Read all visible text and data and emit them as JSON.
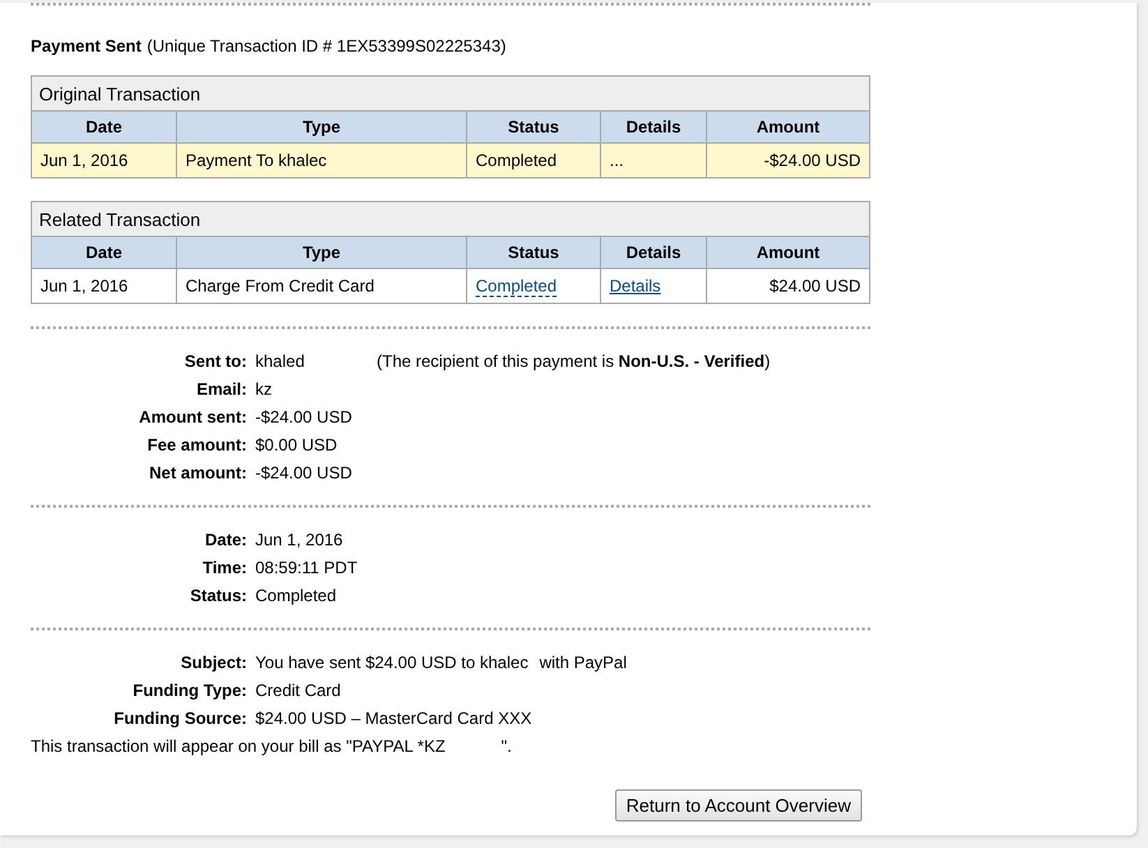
{
  "header": {
    "title": "Payment Sent",
    "transaction_id": "(Unique Transaction ID # 1EX53399S02225343)"
  },
  "tables": [
    {
      "title": "Original Transaction",
      "columns": [
        "Date",
        "Type",
        "Status",
        "Details",
        "Amount"
      ],
      "rows": [
        {
          "highlighted": true,
          "date": "Jun 1, 2016",
          "type": "Payment To khalec",
          "status": {
            "kind": "text",
            "text": "Completed"
          },
          "details": {
            "kind": "text",
            "text": "..."
          },
          "amount": "-$24.00 USD"
        }
      ]
    },
    {
      "title": "Related Transaction",
      "columns": [
        "Date",
        "Type",
        "Status",
        "Details",
        "Amount"
      ],
      "rows": [
        {
          "highlighted": false,
          "date": "Jun 1, 2016",
          "type": "Charge From Credit Card",
          "status": {
            "kind": "tooltip-link",
            "text": "Completed"
          },
          "details": {
            "kind": "link",
            "text": "Details"
          },
          "amount": "$24.00 USD"
        }
      ]
    }
  ],
  "sections": [
    {
      "fields": [
        {
          "label": "Sent to:",
          "value": "khaled",
          "note": "(The recipient of this payment is **Non-U.S. - Verified**)"
        },
        {
          "label": "Email:",
          "value": "kz"
        },
        {
          "label": "Amount sent:",
          "value": "-$24.00 USD"
        },
        {
          "label": "Fee amount:",
          "value": "$0.00 USD"
        },
        {
          "label": "Net amount:",
          "value": "-$24.00 USD"
        }
      ]
    },
    {
      "fields": [
        {
          "label": "Date:",
          "value": "Jun 1, 2016"
        },
        {
          "label": "Time:",
          "value": "08:59:11 PDT"
        },
        {
          "label": "Status:",
          "value": "Completed"
        }
      ]
    },
    {
      "fields": [
        {
          "label": "Subject:",
          "value": "You have sent $24.00 USD to khalec",
          "note": "with PayPal"
        },
        {
          "label": "Funding Type:",
          "value": "Credit Card"
        },
        {
          "label": "Funding Source:",
          "value": "$24.00 USD – MasterCard Card XXX"
        }
      ],
      "footnote": "This transaction will appear on your bill as \"PAYPAL *KZ",
      "footnote_end": "\"."
    }
  ],
  "button": "Return to Account Overview"
}
